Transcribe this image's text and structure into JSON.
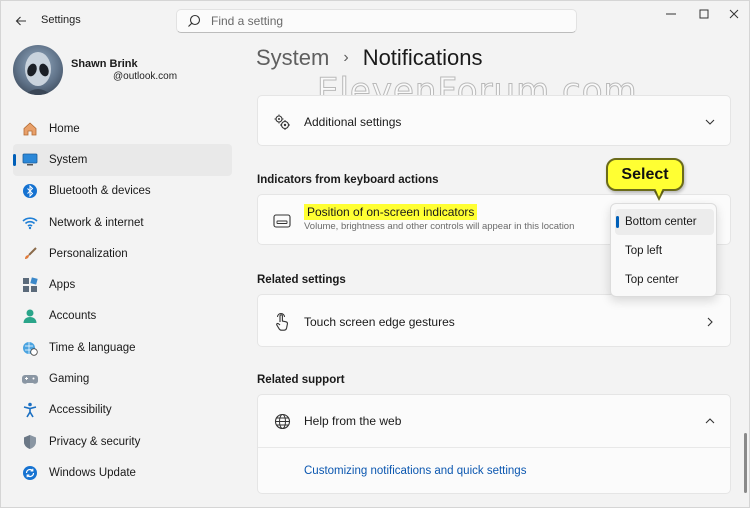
{
  "window": {
    "title": "Settings"
  },
  "search": {
    "placeholder": "Find a setting"
  },
  "profile": {
    "name": "Shawn Brink",
    "email": "@outlook.com"
  },
  "sidebar": {
    "items": [
      {
        "label": "Home",
        "icon": "home-icon"
      },
      {
        "label": "System",
        "icon": "system-icon",
        "selected": true
      },
      {
        "label": "Bluetooth & devices",
        "icon": "bluetooth-icon"
      },
      {
        "label": "Network & internet",
        "icon": "wifi-icon"
      },
      {
        "label": "Personalization",
        "icon": "brush-icon"
      },
      {
        "label": "Apps",
        "icon": "apps-icon"
      },
      {
        "label": "Accounts",
        "icon": "accounts-icon"
      },
      {
        "label": "Time & language",
        "icon": "globe-clock-icon"
      },
      {
        "label": "Gaming",
        "icon": "gamepad-icon"
      },
      {
        "label": "Accessibility",
        "icon": "accessibility-icon"
      },
      {
        "label": "Privacy & security",
        "icon": "shield-icon"
      },
      {
        "label": "Windows Update",
        "icon": "update-icon"
      }
    ]
  },
  "breadcrumb": {
    "parent": "System",
    "separator": "›",
    "current": "Notifications"
  },
  "watermark": "ElevenForum.com",
  "additional_settings": {
    "label": "Additional settings"
  },
  "indicators": {
    "heading": "Indicators from keyboard actions",
    "title": "Position of on-screen indicators",
    "description": "Volume, brightness and other controls will appear in this location"
  },
  "dropdown": {
    "options": [
      "Bottom center",
      "Top left",
      "Top center"
    ],
    "selected": "Bottom center"
  },
  "callout": "Select",
  "related_settings": {
    "heading": "Related settings",
    "item": "Touch screen edge gestures"
  },
  "related_support": {
    "heading": "Related support",
    "item": "Help from the web",
    "link": "Customizing notifications and quick settings"
  },
  "colors": {
    "accent": "#005fb8",
    "highlight": "#ffff33",
    "link": "#0b57b0"
  }
}
